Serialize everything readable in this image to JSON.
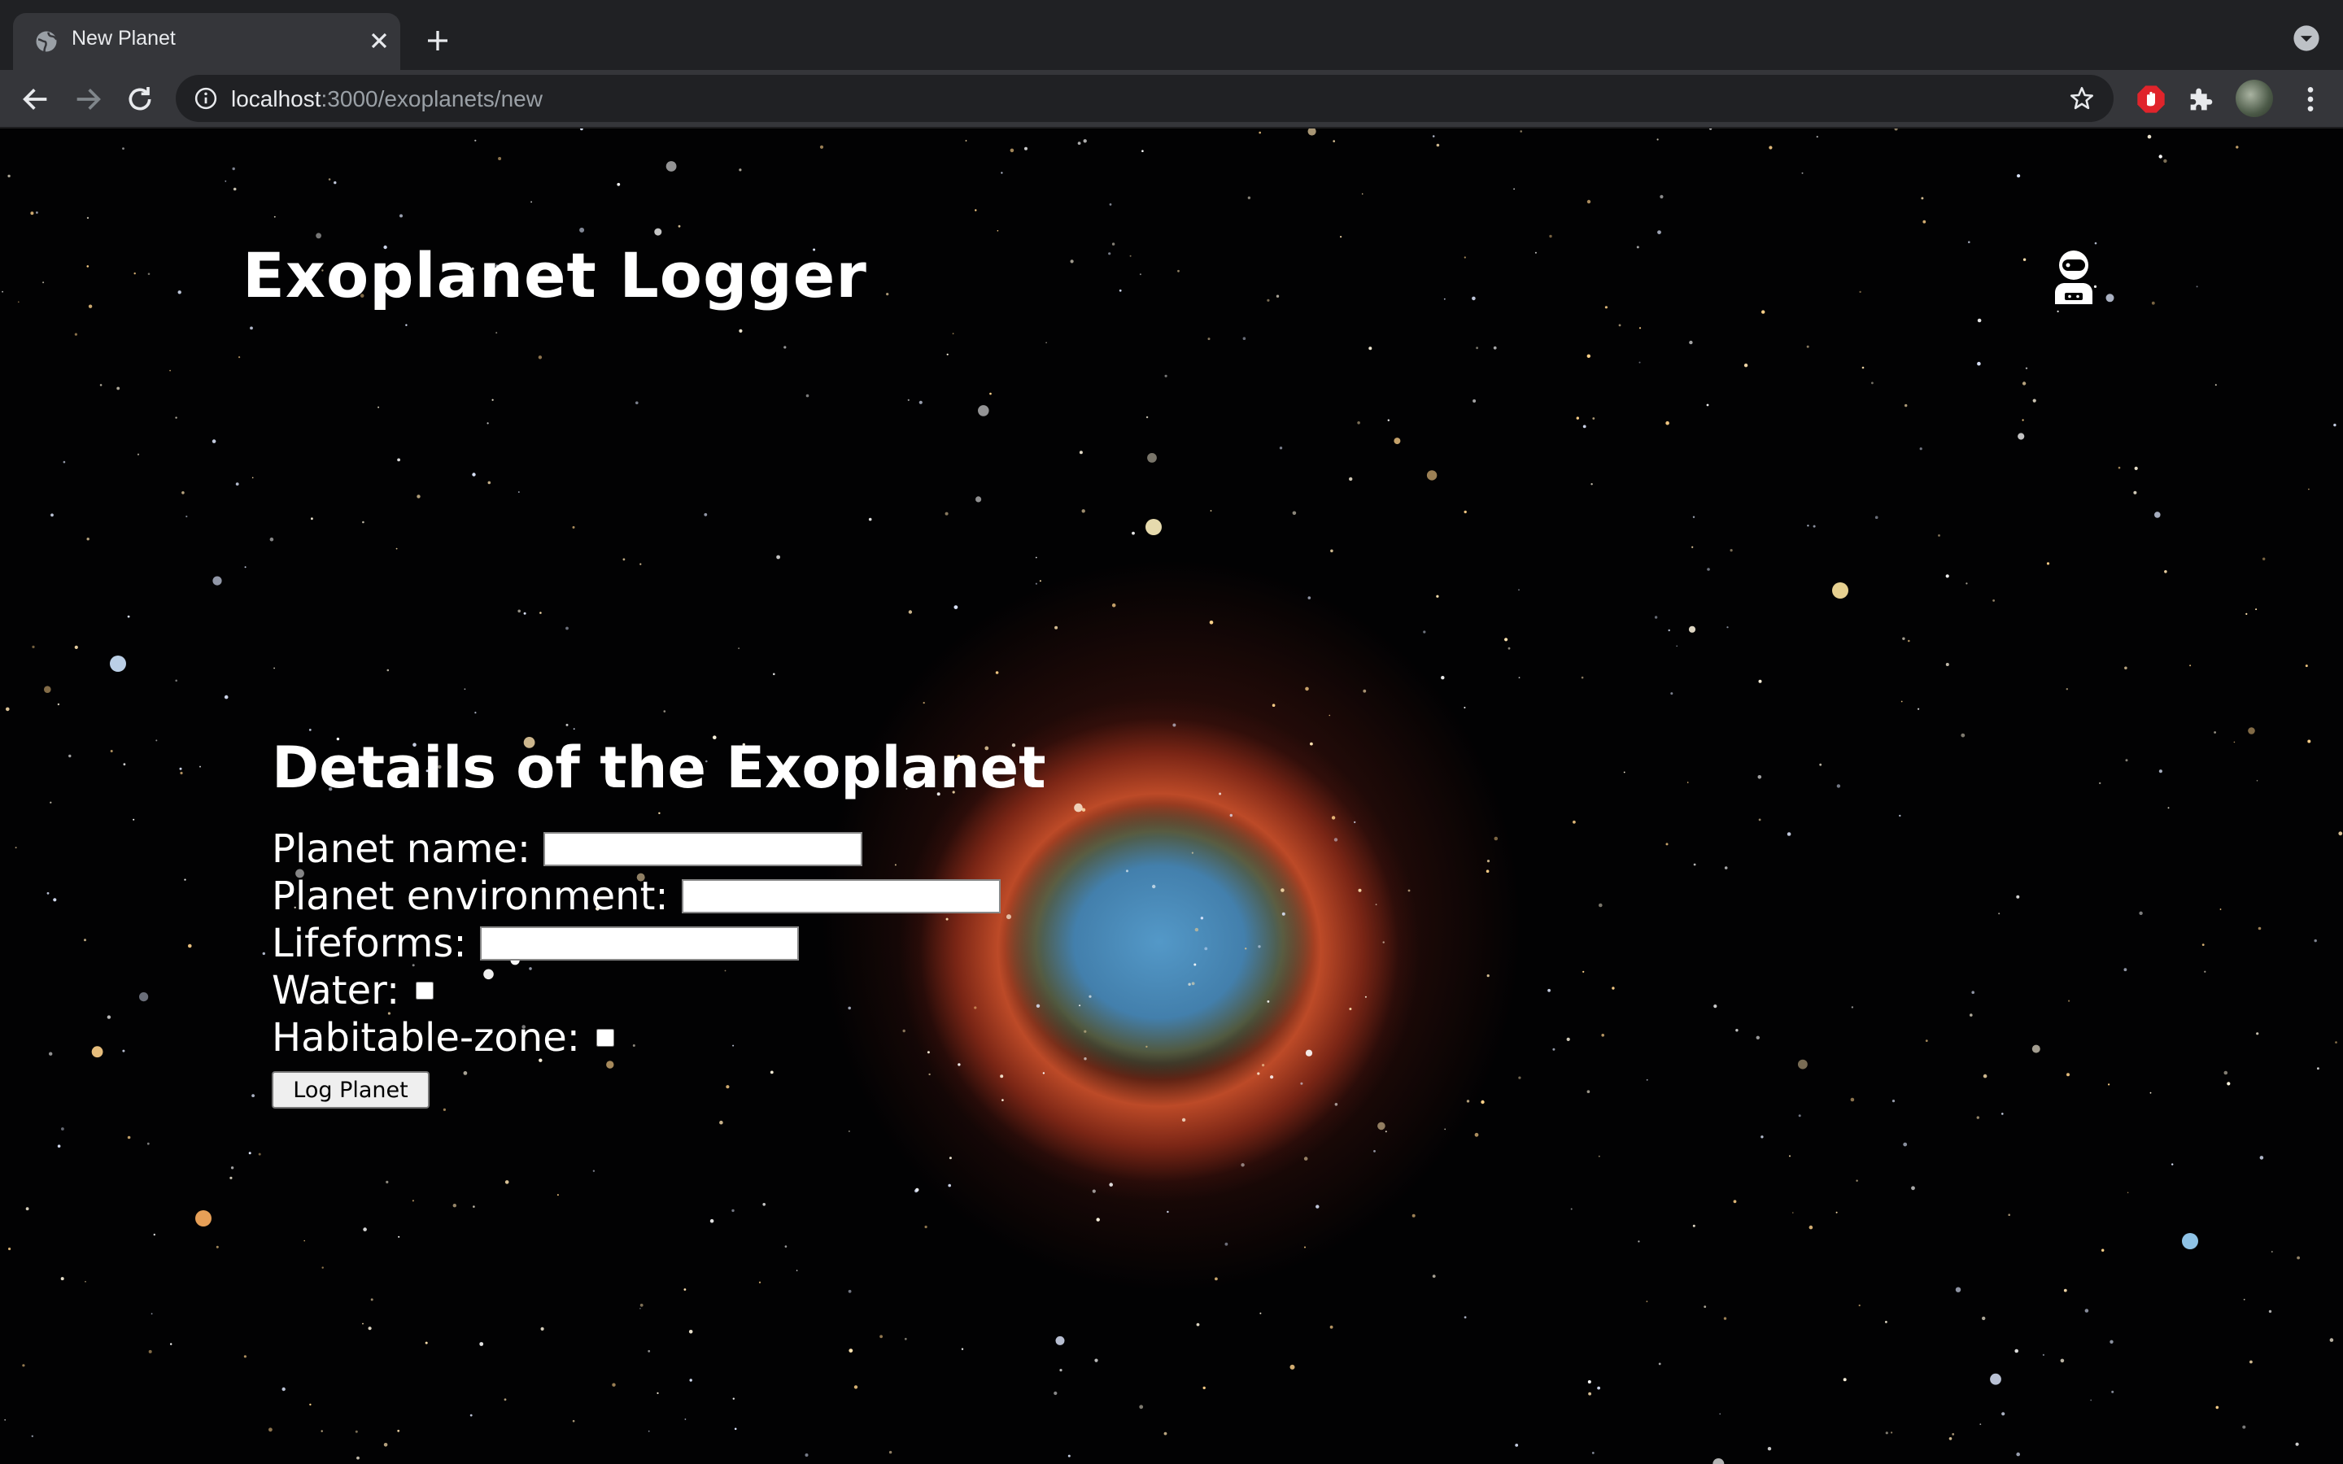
{
  "browser": {
    "tab_title": "New Planet",
    "url_host": "localhost",
    "url_path": ":3000/exoplanets/new"
  },
  "header": {
    "site_title": "Exoplanet Logger",
    "user_icon": "astronaut-icon"
  },
  "form": {
    "title": "Details of the Exoplanet",
    "fields": [
      {
        "label": "Planet name:",
        "type": "text",
        "value": ""
      },
      {
        "label": "Planet environment:",
        "type": "text",
        "value": ""
      },
      {
        "label": "Lifeforms:",
        "type": "text",
        "value": ""
      },
      {
        "label": "Water:",
        "type": "checkbox",
        "checked": false
      },
      {
        "label": "Habitable-zone:",
        "type": "checkbox",
        "checked": false
      }
    ],
    "submit_label": "Log Planet"
  },
  "colors": {
    "text": "#ffffff",
    "background": "#000000",
    "nebula_outer": "#d2552d",
    "nebula_inner": "#4f9fd0"
  }
}
